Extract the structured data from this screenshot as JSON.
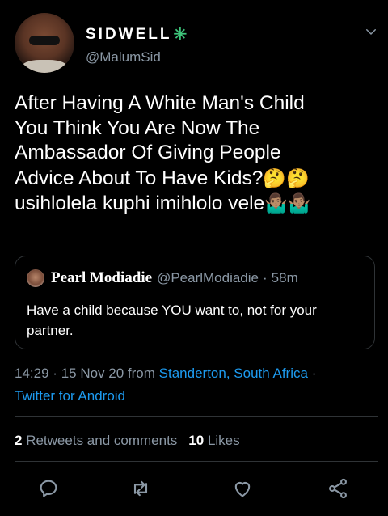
{
  "author": {
    "display_name": "SIDWELL",
    "verified_glyph": "✳",
    "handle": "@MalumSid",
    "avatar_icon": "profile-photo"
  },
  "tweet": {
    "line1": "After Having A White Man's Child",
    "line2": "You Think You Are Now The",
    "line3": "Ambassador Of Giving People",
    "line4": "Advice About To Have Kids?",
    "line4_emoji": "🤔🤔",
    "line5": "usihlolela kuphi imihlolo vele",
    "line5_emoji": "🤷🏽‍♂️🤷🏽‍♂️"
  },
  "quote": {
    "name": "Pearl Modiadie",
    "handle": "@PearlModiadie",
    "separator": "·",
    "time": "58m",
    "text": "Have a child because YOU want to, not for your partner."
  },
  "meta": {
    "time": "14:29",
    "separator": "·",
    "date": "15 Nov 20",
    "from_label": "from",
    "location": "Standerton, South Africa",
    "source": "Twitter for Android"
  },
  "stats": {
    "retweets_count": "2",
    "retweets_label": "Retweets and comments",
    "likes_count": "10",
    "likes_label": "Likes"
  },
  "colors": {
    "background": "#000000",
    "text": "#ffffff",
    "secondary": "#8b98a5",
    "link": "#1d9bf0",
    "verified": "#3ec47a",
    "border": "#2f3336"
  },
  "icons": [
    "chevron-down-icon",
    "reply-icon",
    "retweet-icon",
    "like-icon",
    "share-icon"
  ]
}
